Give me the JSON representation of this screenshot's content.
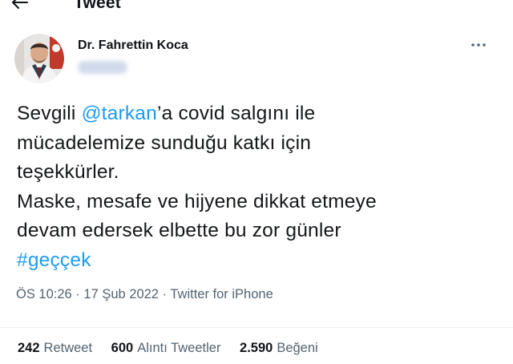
{
  "header": {
    "title": "Tweet",
    "back_icon": "arrow-left-icon"
  },
  "author": {
    "name": "Dr. Fahrettin Koca",
    "more_icon": "more-horizontal-icon",
    "avatar_icon": "avatar"
  },
  "tweet": {
    "line1_pre": "Sevgili ",
    "line1_mention": "@tarkan",
    "line1_post": "’a covid salgını ile",
    "line2": "mücadelemize sunduğu katkı için",
    "line3": "teşekkürler.",
    "line4": "Maske, mesafe ve hijyene dikkat etmeye",
    "line5": "devam edersek elbette bu zor günler",
    "hashtag": "#geççek"
  },
  "meta": {
    "time": "ÖS 10:26",
    "separator1": " · ",
    "date": "17 Şub 2022",
    "separator2": " · ",
    "source": "Twitter for iPhone"
  },
  "stats": {
    "retweets_count": "242",
    "retweets_label": "Retweet",
    "quotes_count": "600",
    "quotes_label": "Alıntı Tweetler",
    "likes_count": "2.590",
    "likes_label": "Beğeni"
  },
  "colors": {
    "link": "#1d9bf0",
    "secondary_text": "#536471",
    "primary_text": "#0f1419"
  }
}
